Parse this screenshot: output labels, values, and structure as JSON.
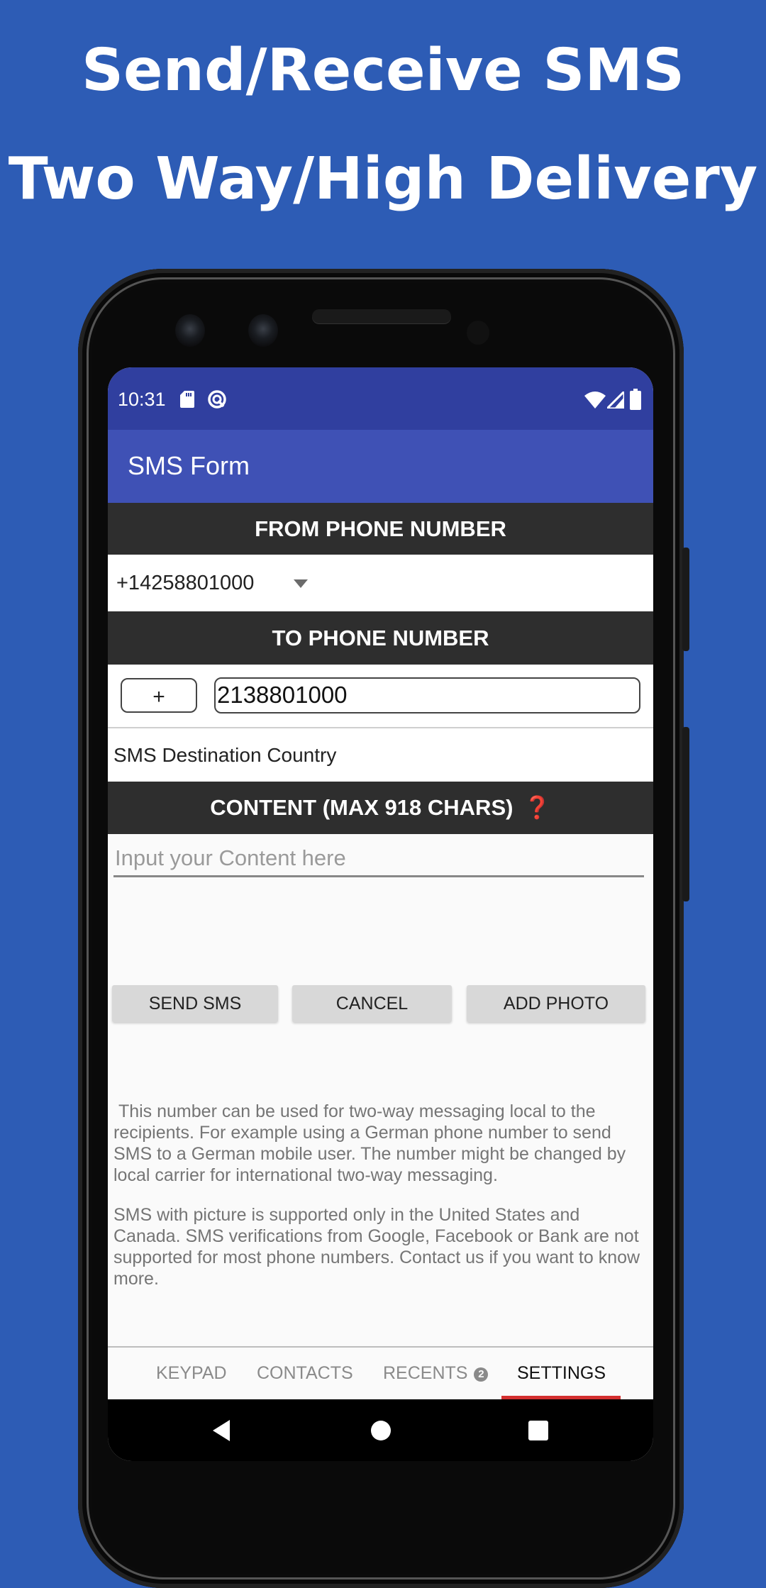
{
  "promo": {
    "headline_line1": "Send/Receive SMS",
    "headline_line2": "Two Way/High Delivery",
    "background_color": "#2d5cb5"
  },
  "status_bar": {
    "time": "10:31",
    "left_icons": [
      "sd-card-icon",
      "data-saver-icon"
    ],
    "right_icons": [
      "wifi-icon",
      "cell-signal-icon",
      "battery-icon"
    ]
  },
  "app_bar": {
    "title": "SMS Form",
    "color": "#3f51b5"
  },
  "form": {
    "from_header": "FROM PHONE NUMBER",
    "from_number_selected": "+14258801000",
    "to_header": "TO PHONE NUMBER",
    "country_code_button": "+",
    "to_number_value": "2138801000",
    "destination_country_label": "SMS Destination Country",
    "content_header": "CONTENT (MAX 918 CHARS)",
    "content_help_icon": "❓",
    "content_placeholder": "Input your Content here",
    "content_value": ""
  },
  "actions": {
    "send": "SEND SMS",
    "cancel": "CANCEL",
    "add_photo": "ADD PHOTO"
  },
  "info": {
    "paragraph1": " This number can be used for two-way messaging local to the recipients. For example using a German phone number to send SMS to a German mobile user. The number might be changed by local carrier for international two-way messaging.",
    "paragraph2": "SMS with picture is supported only in the United States and Canada. SMS verifications from Google, Facebook or Bank are not supported for most phone numbers. Contact us if you want to know more."
  },
  "tabs": [
    {
      "label": "KEYPAD",
      "active": false
    },
    {
      "label": "CONTACTS",
      "active": false
    },
    {
      "label": "RECENTS",
      "badge": "2",
      "active": false
    },
    {
      "label": "SETTINGS",
      "active": true
    }
  ],
  "tab_indicator_color": "#d32f2f",
  "nav_bar": {
    "buttons": [
      "back-icon",
      "home-icon",
      "recents-icon"
    ]
  }
}
